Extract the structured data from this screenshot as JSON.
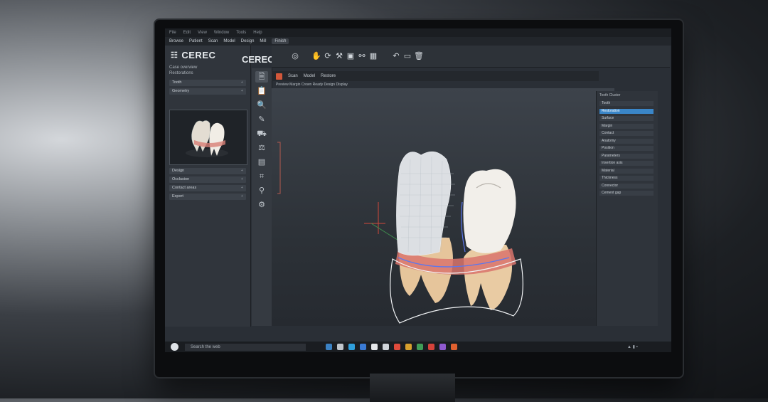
{
  "app": {
    "logo_text": "CEREC",
    "logo_text_2": "CEREC",
    "menubar": [
      "File",
      "Edit",
      "View",
      "Window",
      "Tools",
      "Help"
    ],
    "tabs": [
      {
        "label": "Browse",
        "active": false
      },
      {
        "label": "Patient",
        "active": false
      },
      {
        "label": "Scan",
        "active": false
      },
      {
        "label": "Model",
        "active": false
      },
      {
        "label": "Design",
        "active": false
      },
      {
        "label": "Mill",
        "active": false
      },
      {
        "label": "Finish",
        "active": true
      }
    ]
  },
  "left_panel": {
    "section_title": "Case overview",
    "subtitle": "Restorations",
    "rows_top": [
      {
        "label": "Tooth",
        "chev": "+"
      },
      {
        "label": "Geometry",
        "chev": "+"
      }
    ],
    "rows_bottom": [
      {
        "label": "Design",
        "chev": "+"
      },
      {
        "label": "Occlusion",
        "chev": "+"
      },
      {
        "label": "Contact areas",
        "chev": "+"
      },
      {
        "label": "Export",
        "chev": "+"
      }
    ]
  },
  "subbar": {
    "items": [
      "Scan",
      "Model",
      "Restore"
    ]
  },
  "infobar": {
    "text": "Preview  Margin  Crown  Ready  Design  Display"
  },
  "right_panel": {
    "title": "Tooth Cluster",
    "rows": [
      {
        "label": "Tooth",
        "selected": false
      },
      {
        "label": "Restoration",
        "selected": true
      },
      {
        "label": "Surface",
        "selected": false
      },
      {
        "label": "Margin",
        "selected": false
      },
      {
        "label": "Contact",
        "selected": false
      },
      {
        "label": "Anatomy",
        "selected": false
      },
      {
        "label": "Position",
        "selected": false
      },
      {
        "label": "Parameters",
        "selected": false
      },
      {
        "label": "Insertion axis",
        "selected": false
      },
      {
        "label": "Material",
        "selected": false
      },
      {
        "label": "Thickness",
        "selected": false
      },
      {
        "label": "Connector",
        "selected": false
      },
      {
        "label": "Cement gap",
        "selected": false
      }
    ]
  },
  "taskbar": {
    "search_placeholder": "Search the web",
    "app_colors": [
      "#3b82c4",
      "#c0c6cc",
      "#2f9fdc",
      "#3a7bd5",
      "#e5e7ea",
      "#cfd4d9",
      "#e04b3c",
      "#d7a02d",
      "#3f9d57",
      "#d5423a",
      "#8f5ad0",
      "#e0602f"
    ]
  },
  "colors": {
    "accent": "#3a86c8",
    "viewport_bg": "#2d3238",
    "tooth": "#e9e4db",
    "gum": "#d97a72",
    "root": "#e7c9a1",
    "margin_line": "#4a6ff0"
  }
}
